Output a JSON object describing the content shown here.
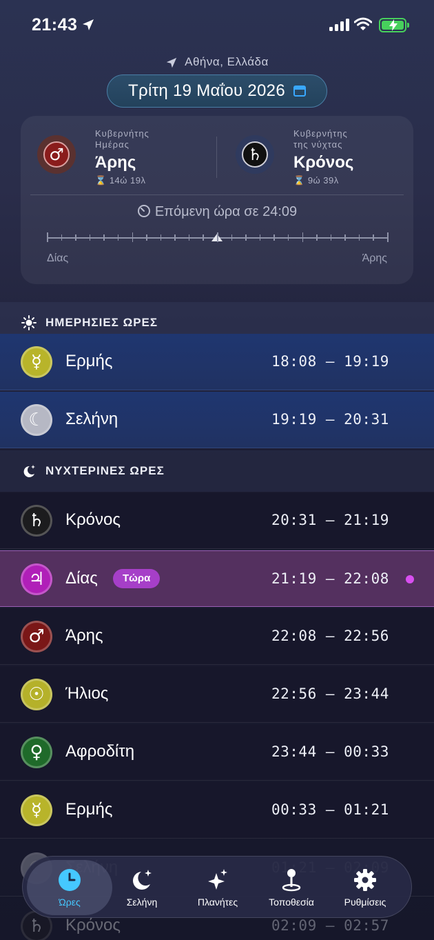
{
  "status_bar": {
    "time": "21:43"
  },
  "header": {
    "location": "Αθήνα, Ελλάδα",
    "date": "Τρίτη 19 Μαΐου 2026"
  },
  "rulers": {
    "day": {
      "caption_line1": "Κυβερνήτης",
      "caption_line2": "Ημέρας",
      "planet": "Άρης",
      "duration": "14ώ 19λ",
      "symbol": "♂",
      "color": "#8a1c1c"
    },
    "night": {
      "caption_line1": "Κυβερνήτης",
      "caption_line2": "της νύχτας",
      "planet": "Κρόνος",
      "duration": "9ώ 39λ",
      "symbol": "♄",
      "color": "#1a1a1a"
    }
  },
  "next_hour": {
    "text": "Επόμενη ώρα σε 24:09",
    "progress_fraction": 0.5
  },
  "scale": {
    "left_label": "Δίας",
    "right_label": "Άρης"
  },
  "day_section": {
    "title": "ΗΜΕΡΗΣΙΕΣ ΩΡΕΣ",
    "rows": [
      {
        "planet": "Ερμής",
        "time": "18:08 – 19:19",
        "symbol": "☿",
        "color": "#b8b42a"
      },
      {
        "planet": "Σελήνη",
        "time": "19:19 – 20:31",
        "symbol": "☾",
        "color": "#b6b8c4"
      }
    ]
  },
  "night_section": {
    "title": "ΝΥΧΤΕΡΙΝΕΣ ΩΡΕΣ",
    "rows": [
      {
        "planet": "Κρόνος",
        "time": "20:31 – 21:19",
        "symbol": "♄",
        "color": "#1c1c1e"
      },
      {
        "planet": "Δίας",
        "time": "21:19 – 22:08",
        "symbol": "♃",
        "color": "#b01fb8",
        "badge": "Τώρα"
      },
      {
        "planet": "Άρης",
        "time": "22:08 – 22:56",
        "symbol": "♂",
        "color": "#7a1717"
      },
      {
        "planet": "Ήλιος",
        "time": "22:56 – 23:44",
        "symbol": "☉",
        "color": "#b5b12a"
      },
      {
        "planet": "Αφροδίτη",
        "time": "23:44 – 00:33",
        "symbol": "♀",
        "color": "#1f6a2a"
      },
      {
        "planet": "Ερμής",
        "time": "00:33 – 01:21",
        "symbol": "☿",
        "color": "#b8b42a"
      },
      {
        "planet": "Σελήνη",
        "time": "01:21 – 02:09",
        "symbol": "☾",
        "color": "#b6b8c4"
      },
      {
        "planet": "Κρόνος",
        "time": "02:09 – 02:57",
        "symbol": "♄",
        "color": "#1c1c1e"
      }
    ]
  },
  "tabs": [
    {
      "label": "Ώρες",
      "icon": "clock-icon",
      "active": true
    },
    {
      "label": "Σελήνη",
      "icon": "moon-stars-icon"
    },
    {
      "label": "Πλανήτες",
      "icon": "sparkles-icon"
    },
    {
      "label": "Τοποθεσία",
      "icon": "map-pin-icon"
    },
    {
      "label": "Ρυθμίσεις",
      "icon": "gear-icon"
    }
  ]
}
